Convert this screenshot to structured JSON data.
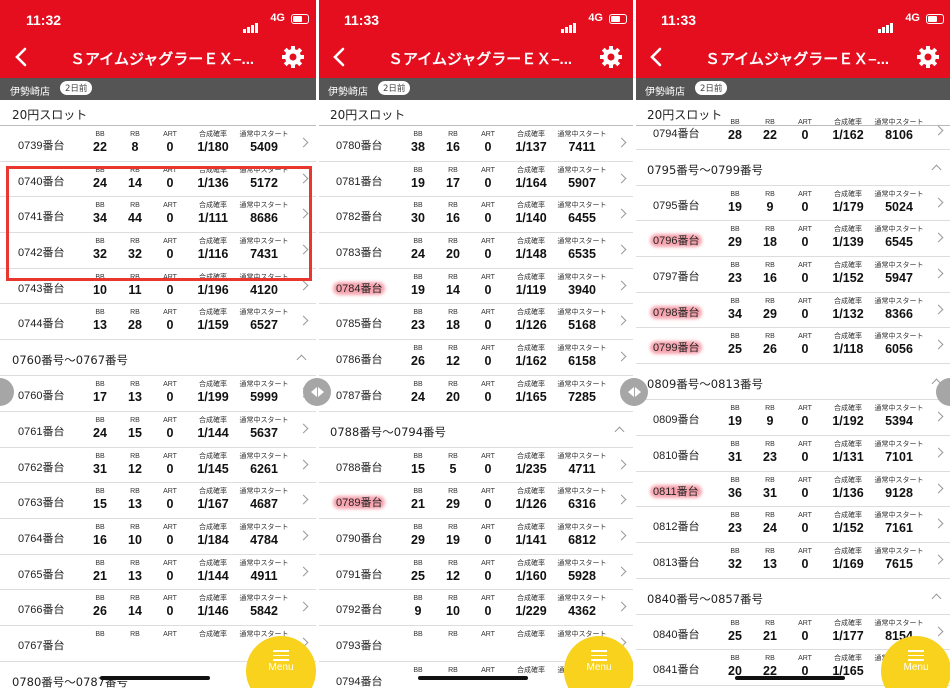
{
  "status": {
    "time1": "11:32",
    "time2": "11:33",
    "time3": "11:33",
    "network": "4G"
  },
  "nav": {
    "title": "ＳアイムジャグラーＥＸ–...",
    "back_icon": "chevron-left-icon",
    "settings_icon": "gear-icon"
  },
  "store": {
    "name": "伊勢崎店",
    "days": "2日前"
  },
  "category": "20円スロット",
  "labels": {
    "bb": "BB",
    "rb": "RB",
    "art": "ART",
    "rate": "合成確率",
    "start": "通常中スタート"
  },
  "menu_label": "Menu",
  "colors": {
    "header": "#e40e1f",
    "menu": "#f8d21c",
    "highlight_box": "#e8372f"
  },
  "screen1": {
    "rows": [
      {
        "type": "row",
        "machine": "0739番台",
        "bb": "22",
        "rb": "8",
        "art": "0",
        "rate": "1/180",
        "start": "5409"
      },
      {
        "type": "row",
        "machine": "0740番台",
        "bb": "24",
        "rb": "14",
        "art": "0",
        "rate": "1/136",
        "start": "5172"
      },
      {
        "type": "row",
        "machine": "0741番台",
        "bb": "34",
        "rb": "44",
        "art": "0",
        "rate": "1/111",
        "start": "8686"
      },
      {
        "type": "row",
        "machine": "0742番台",
        "bb": "32",
        "rb": "32",
        "art": "0",
        "rate": "1/116",
        "start": "7431"
      },
      {
        "type": "row",
        "machine": "0743番台",
        "bb": "10",
        "rb": "11",
        "art": "0",
        "rate": "1/196",
        "start": "4120"
      },
      {
        "type": "row",
        "machine": "0744番台",
        "bb": "13",
        "rb": "28",
        "art": "0",
        "rate": "1/159",
        "start": "6527"
      },
      {
        "type": "group",
        "label": "0760番号〜0767番号"
      },
      {
        "type": "row",
        "machine": "0760番台",
        "bb": "17",
        "rb": "13",
        "art": "0",
        "rate": "1/199",
        "start": "5999"
      },
      {
        "type": "row",
        "machine": "0761番台",
        "bb": "24",
        "rb": "15",
        "art": "0",
        "rate": "1/144",
        "start": "5637"
      },
      {
        "type": "row",
        "machine": "0762番台",
        "bb": "31",
        "rb": "12",
        "art": "0",
        "rate": "1/145",
        "start": "6261"
      },
      {
        "type": "row",
        "machine": "0763番台",
        "bb": "15",
        "rb": "13",
        "art": "0",
        "rate": "1/167",
        "start": "4687"
      },
      {
        "type": "row",
        "machine": "0764番台",
        "bb": "16",
        "rb": "10",
        "art": "0",
        "rate": "1/184",
        "start": "4784"
      },
      {
        "type": "row",
        "machine": "0765番台",
        "bb": "21",
        "rb": "13",
        "art": "0",
        "rate": "1/144",
        "start": "4911"
      },
      {
        "type": "row",
        "machine": "0766番台",
        "bb": "26",
        "rb": "14",
        "art": "0",
        "rate": "1/146",
        "start": "5842"
      },
      {
        "type": "row",
        "machine": "0767番台",
        "bb": "",
        "rb": "",
        "art": "",
        "rate": "",
        "start": ""
      },
      {
        "type": "group",
        "label": "0780番号〜0787番号"
      }
    ]
  },
  "screen2": {
    "rows": [
      {
        "type": "row",
        "machine": "0780番台",
        "bb": "38",
        "rb": "16",
        "art": "0",
        "rate": "1/137",
        "start": "7411"
      },
      {
        "type": "row",
        "machine": "0781番台",
        "bb": "19",
        "rb": "17",
        "art": "0",
        "rate": "1/164",
        "start": "5907"
      },
      {
        "type": "row",
        "machine": "0782番台",
        "bb": "30",
        "rb": "16",
        "art": "0",
        "rate": "1/140",
        "start": "6455"
      },
      {
        "type": "row",
        "machine": "0783番台",
        "bb": "24",
        "rb": "20",
        "art": "0",
        "rate": "1/148",
        "start": "6535"
      },
      {
        "type": "row",
        "machine": "0784番台",
        "bb": "19",
        "rb": "14",
        "art": "0",
        "rate": "1/119",
        "start": "3940",
        "hl": true
      },
      {
        "type": "row",
        "machine": "0785番台",
        "bb": "23",
        "rb": "18",
        "art": "0",
        "rate": "1/126",
        "start": "5168"
      },
      {
        "type": "row",
        "machine": "0786番台",
        "bb": "26",
        "rb": "12",
        "art": "0",
        "rate": "1/162",
        "start": "6158"
      },
      {
        "type": "row",
        "machine": "0787番台",
        "bb": "24",
        "rb": "20",
        "art": "0",
        "rate": "1/165",
        "start": "7285"
      },
      {
        "type": "group",
        "label": "0788番号〜0794番号"
      },
      {
        "type": "row",
        "machine": "0788番台",
        "bb": "15",
        "rb": "5",
        "art": "0",
        "rate": "1/235",
        "start": "4711"
      },
      {
        "type": "row",
        "machine": "0789番台",
        "bb": "21",
        "rb": "29",
        "art": "0",
        "rate": "1/126",
        "start": "6316",
        "hl": true
      },
      {
        "type": "row",
        "machine": "0790番台",
        "bb": "29",
        "rb": "19",
        "art": "0",
        "rate": "1/141",
        "start": "6812"
      },
      {
        "type": "row",
        "machine": "0791番台",
        "bb": "25",
        "rb": "12",
        "art": "0",
        "rate": "1/160",
        "start": "5928"
      },
      {
        "type": "row",
        "machine": "0792番台",
        "bb": "9",
        "rb": "10",
        "art": "0",
        "rate": "1/229",
        "start": "4362"
      },
      {
        "type": "row",
        "machine": "0793番台",
        "bb": "",
        "rb": "",
        "art": "",
        "rate": "",
        "start": ""
      },
      {
        "type": "row",
        "machine": "0794番台",
        "bb": "",
        "rb": "",
        "art": "",
        "rate": "",
        "start": ""
      }
    ]
  },
  "screen3": {
    "rows": [
      {
        "type": "row",
        "machine": "0794番台",
        "bb": "28",
        "rb": "22",
        "art": "0",
        "rate": "1/162",
        "start": "8106"
      },
      {
        "type": "group",
        "label": "0795番号〜0799番号"
      },
      {
        "type": "row",
        "machine": "0795番台",
        "bb": "19",
        "rb": "9",
        "art": "0",
        "rate": "1/179",
        "start": "5024"
      },
      {
        "type": "row",
        "machine": "0796番台",
        "bb": "29",
        "rb": "18",
        "art": "0",
        "rate": "1/139",
        "start": "6545",
        "hl": true
      },
      {
        "type": "row",
        "machine": "0797番台",
        "bb": "23",
        "rb": "16",
        "art": "0",
        "rate": "1/152",
        "start": "5947"
      },
      {
        "type": "row",
        "machine": "0798番台",
        "bb": "34",
        "rb": "29",
        "art": "0",
        "rate": "1/132",
        "start": "8366",
        "hl": true
      },
      {
        "type": "row",
        "machine": "0799番台",
        "bb": "25",
        "rb": "26",
        "art": "0",
        "rate": "1/118",
        "start": "6056",
        "hl": true
      },
      {
        "type": "group",
        "label": "0809番号〜0813番号"
      },
      {
        "type": "row",
        "machine": "0809番台",
        "bb": "19",
        "rb": "9",
        "art": "0",
        "rate": "1/192",
        "start": "5394"
      },
      {
        "type": "row",
        "machine": "0810番台",
        "bb": "31",
        "rb": "23",
        "art": "0",
        "rate": "1/131",
        "start": "7101"
      },
      {
        "type": "row",
        "machine": "0811番台",
        "bb": "36",
        "rb": "31",
        "art": "0",
        "rate": "1/136",
        "start": "9128",
        "hl": true
      },
      {
        "type": "row",
        "machine": "0812番台",
        "bb": "23",
        "rb": "24",
        "art": "0",
        "rate": "1/152",
        "start": "7161"
      },
      {
        "type": "row",
        "machine": "0813番台",
        "bb": "32",
        "rb": "13",
        "art": "0",
        "rate": "1/169",
        "start": "7615"
      },
      {
        "type": "group",
        "label": "0840番号〜0857番号"
      },
      {
        "type": "row",
        "machine": "0840番台",
        "bb": "25",
        "rb": "21",
        "art": "0",
        "rate": "1/177",
        "start": "8154"
      },
      {
        "type": "row",
        "machine": "0841番台",
        "bb": "20",
        "rb": "22",
        "art": "0",
        "rate": "1/165",
        "start": ""
      }
    ]
  }
}
